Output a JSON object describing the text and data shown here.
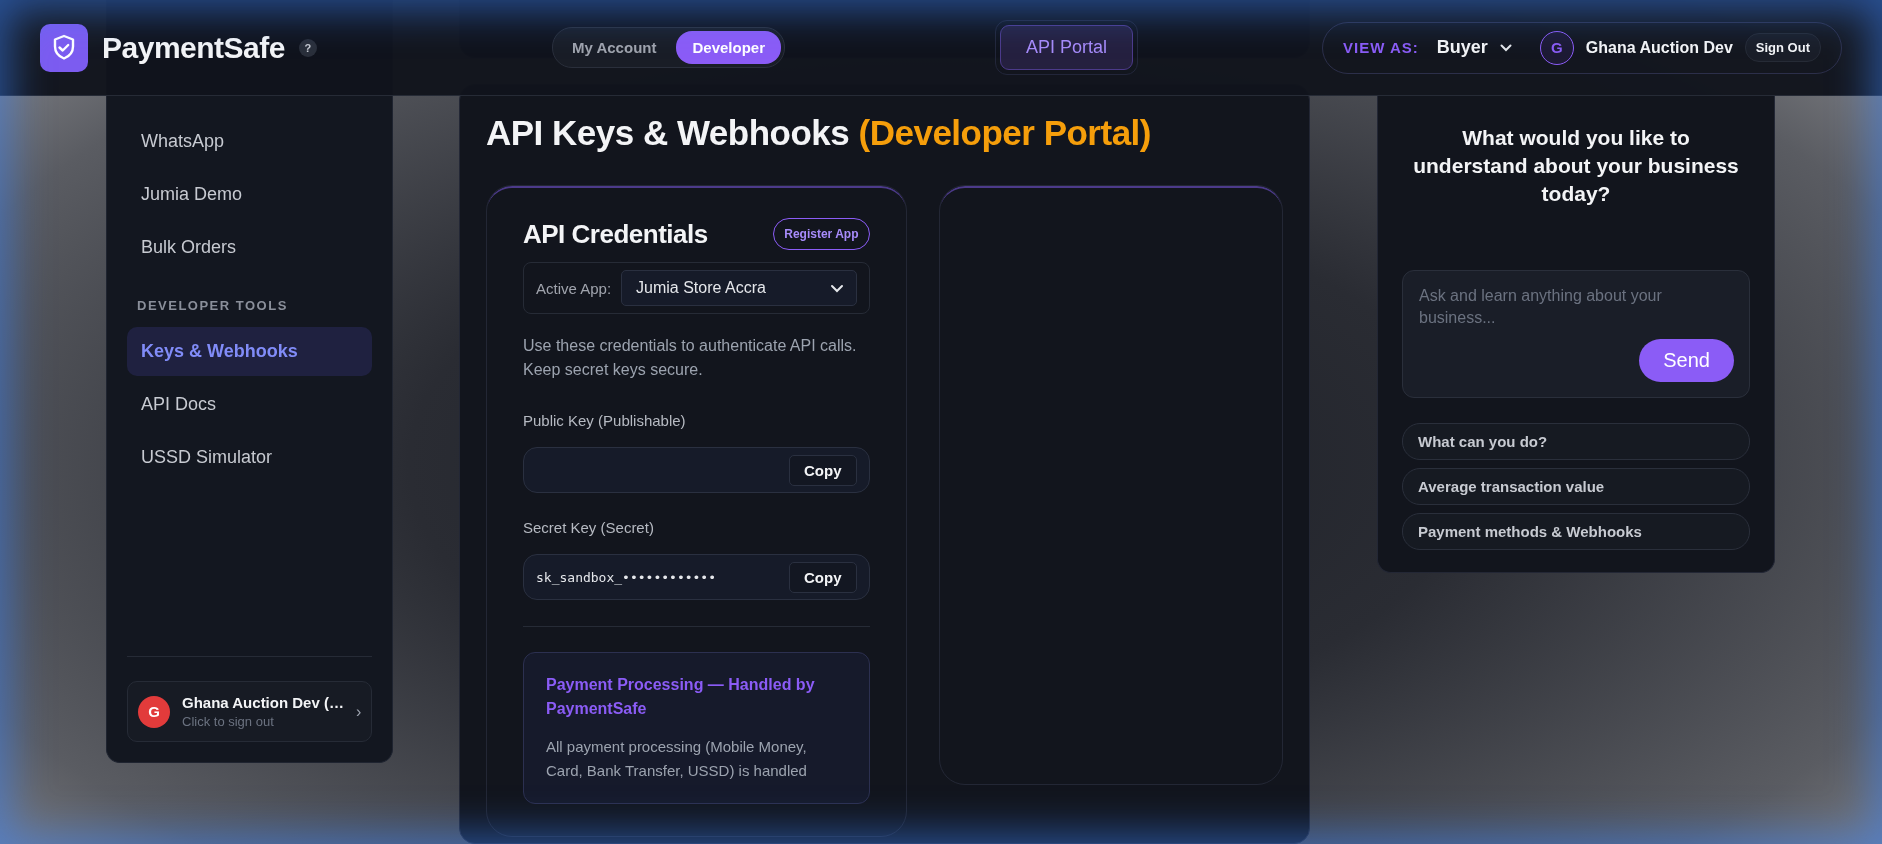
{
  "header": {
    "brand": "PaymentSafe",
    "help": "?",
    "mode_tabs": [
      {
        "label": "My Account",
        "selected": false
      },
      {
        "label": "Developer",
        "selected": true
      }
    ],
    "portal_button": "API Portal",
    "view_as_label": "VIEW AS:",
    "view_as_value": "Buyer",
    "user_initial": "G",
    "user_name": "Ghana Auction Dev",
    "sign_out": "Sign Out"
  },
  "sidebar": {
    "groups": [
      {
        "items": [
          {
            "label": "WhatsApp",
            "selected": false
          },
          {
            "label": "Jumia Demo",
            "selected": false
          },
          {
            "label": "Bulk Orders",
            "selected": false
          }
        ]
      },
      {
        "heading": "DEVELOPER TOOLS",
        "items": [
          {
            "label": "Keys & Webhooks",
            "selected": true
          },
          {
            "label": "API Docs",
            "selected": false
          },
          {
            "label": "USSD Simulator",
            "selected": false
          }
        ]
      }
    ],
    "account": {
      "initial": "G",
      "name": "Ghana Auction Dev (…",
      "subtitle": "Click to sign out",
      "chevron": "›"
    }
  },
  "main": {
    "title": "API Keys & Webhooks",
    "title_note": "(Developer Portal)",
    "credentials": {
      "title": "API Credentials",
      "register_button": "Register App",
      "active_app_label": "Active App:",
      "active_app": "Jumia Store Accra",
      "description": "Use these credentials to authenticate API calls. Keep secret keys secure.",
      "keys": [
        {
          "label": "Public Key (Publishable)",
          "copy": "Copy"
        },
        {
          "label": "Secret Key (Secret)",
          "value": "sk_sandbox_••••••••••••",
          "copy": "Copy"
        }
      ],
      "notice": {
        "title": "Payment Processing — Handled by PaymentSafe",
        "body": "All payment processing (Mobile Money, Card, Bank Transfer, USSD) is handled"
      }
    }
  },
  "assistant": {
    "question": "What would you like to understand about your business today?",
    "placeholder": "Ask and learn anything about your business...",
    "send": "Send",
    "suggestions": [
      "What can you do?",
      "Average transaction value",
      "Payment methods & Webhooks"
    ]
  }
}
